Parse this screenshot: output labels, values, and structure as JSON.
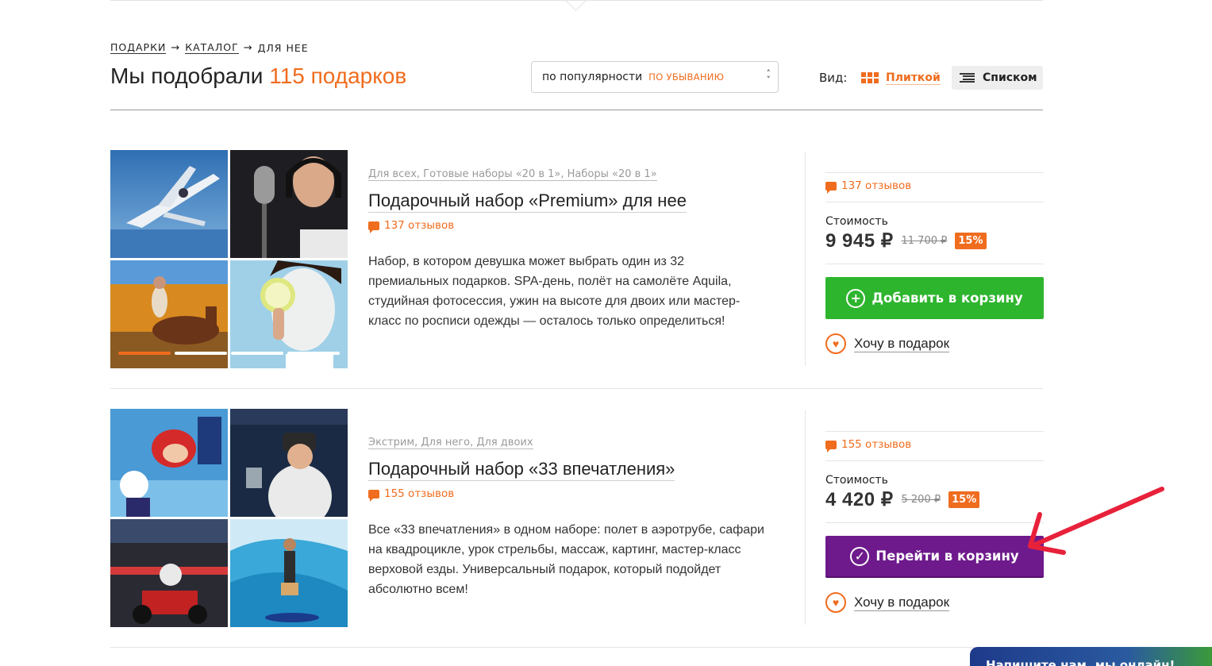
{
  "breadcrumb": {
    "items": [
      "ПОДАРКИ",
      "КАТАЛОГ",
      "ДЛЯ НЕЕ"
    ],
    "separator": "→"
  },
  "heading": {
    "prefix": "Мы подобрали",
    "count": "115 подарков"
  },
  "sort": {
    "value": "по популярности",
    "direction": "ПО УБЫВАНИЮ"
  },
  "view": {
    "label": "Вид:",
    "tiles": "Плиткой",
    "list": "Списком"
  },
  "products": [
    {
      "tags": "Для всех, Готовые наборы «20 в 1», Наборы «20 в 1»",
      "title": "Подарочный набор «Premium» для нее",
      "reviews": "137 отзывов",
      "description": "Набор, в котором девушка может выбрать один из 32 премиальных подарков. SPA-день, полёт на самолёте Aquila, студийная фотосессия, ужин на высоте для двоих или мастер-класс по росписи одежды — осталось только определиться!",
      "cost_label": "Стоимость",
      "price": "9 945 ₽",
      "old_price": "11 700 ₽",
      "discount": "15%",
      "button": "Добавить в корзину",
      "button_icon": "plus-circle-icon",
      "wish": "Хочу в подарок"
    },
    {
      "tags": "Экстрим, Для него, Для двоих",
      "title": "Подарочный набор «33 впечатления»",
      "reviews": "155 отзывов",
      "description": "Все «33 впечатления» в одном наборе: полет в аэротрубе, сафари на квадроцикле, урок стрельбы, массаж, картинг, мастер-класс верховой езды. Универсальный подарок, который подойдет абсолютно всем!",
      "cost_label": "Стоимость",
      "price": "4 420 ₽",
      "old_price": "5 200 ₽",
      "discount": "15%",
      "button": "Перейти в корзину",
      "button_icon": "check-circle-icon",
      "wish": "Хочу в подарок"
    }
  ],
  "chat": {
    "text": "Напишите нам, мы онлайн!"
  },
  "colors": {
    "accent": "#f06c1e",
    "add_button": "#2eb52e",
    "cart_button": "#6e1a8c",
    "annotation_arrow": "#e8213a"
  }
}
